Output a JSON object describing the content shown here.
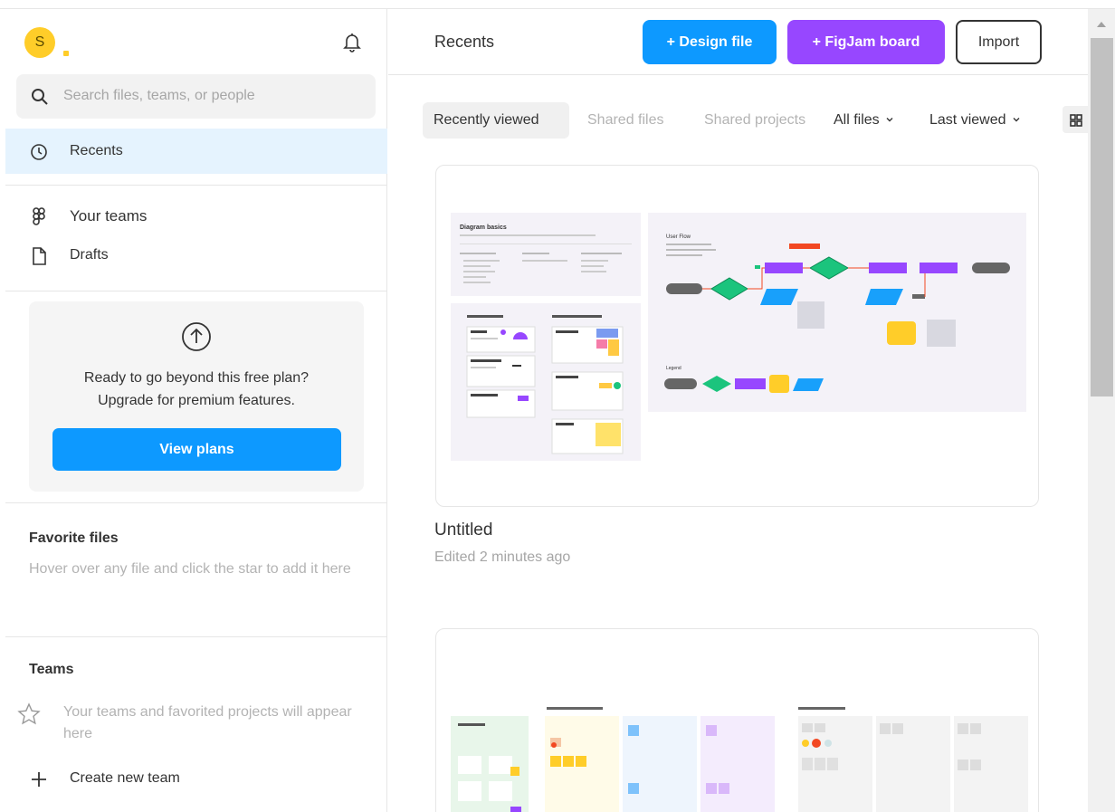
{
  "user": {
    "avatar_initial": "S"
  },
  "search": {
    "placeholder": "Search files, teams, or people"
  },
  "sidebar": {
    "nav": [
      {
        "label": "Recents",
        "icon": "clock-icon",
        "active": true
      },
      {
        "label": "Your teams",
        "icon": "figma-logo-icon"
      },
      {
        "label": "Drafts",
        "icon": "file-icon"
      }
    ],
    "upgrade": {
      "line1": "Ready to go beyond this free plan?",
      "line2": "Upgrade for premium features.",
      "button": "View plans"
    },
    "favorites": {
      "title": "Favorite files",
      "hint": "Hover over any file and click the star to add it here"
    },
    "teams": {
      "title": "Teams",
      "hint": "Your teams and favorited projects will appear here",
      "create_label": "Create new team"
    }
  },
  "header": {
    "title": "Recents",
    "design_button": "+ Design file",
    "figjam_button": "+ FigJam board",
    "import_button": "Import"
  },
  "filters": {
    "tabs": [
      "Recently viewed",
      "Shared files",
      "Shared projects"
    ],
    "active_tab": "Recently viewed",
    "all_files": "All files",
    "sort": "Last viewed"
  },
  "files": [
    {
      "name": "Untitled",
      "meta": "Edited 2 minutes ago"
    }
  ],
  "thumbnail_text": {
    "diagram_basics": "Diagram basics",
    "user_flow": "User Flow",
    "legend": "Legend"
  },
  "colors": {
    "accent_blue": "#0d99ff",
    "figjam_purple": "#9747ff",
    "avatar_yellow": "#ffcd29",
    "active_nav_bg": "#e5f3fe"
  }
}
